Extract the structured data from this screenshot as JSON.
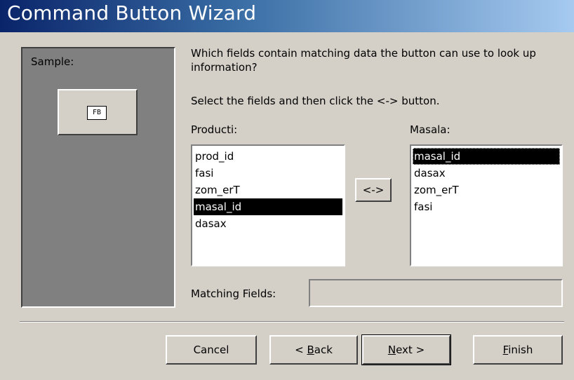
{
  "window": {
    "title": "Command Button Wizard"
  },
  "sample": {
    "label": "Sample:",
    "button_glyph": "FB"
  },
  "prompt": {
    "question": "Which fields contain matching data the button can use to look up information?",
    "instruction": "Select the fields and then click the <-> button."
  },
  "left_list": {
    "label": "Producti:",
    "items": [
      "prod_id",
      "fasi",
      "zom_erT",
      "masal_id",
      "dasax"
    ],
    "selected": "masal_id"
  },
  "right_list": {
    "label": "Masala:",
    "items": [
      "masal_id",
      "dasax",
      "zom_erT",
      "fasi"
    ],
    "selected": "masal_id"
  },
  "match_button": {
    "label": "<->"
  },
  "matching": {
    "label": "Matching Fields:",
    "value": ""
  },
  "buttons": {
    "cancel": "Cancel",
    "back_prefix": "< ",
    "back_mnemonic": "B",
    "back_rest": "ack",
    "next_mnemonic": "N",
    "next_rest": "ext >",
    "finish_mnemonic": "F",
    "finish_rest": "inish"
  }
}
